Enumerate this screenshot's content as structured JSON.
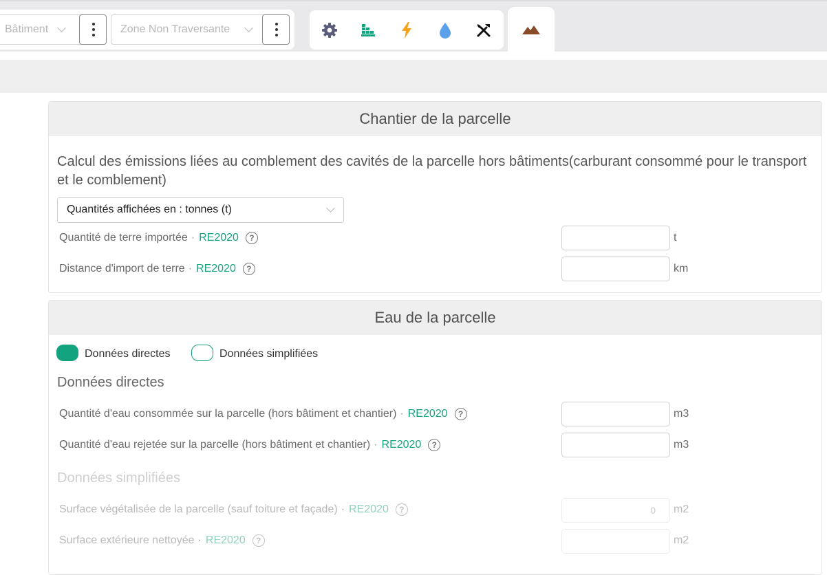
{
  "topbar": {
    "building_select": "Bâtiment",
    "zone_select": "Zone Non Traversante",
    "toolbar_icons": [
      "gear-icon",
      "bricks-icon",
      "lightning-icon",
      "water-drop-icon",
      "tools-icon"
    ],
    "active_tab_icon": "mountain-icon",
    "colors": {
      "gear": "#5b5b7a",
      "bricks": "#14a37f",
      "lightning": "#f5a21c",
      "water": "#5aa0ea",
      "tools": "#111111",
      "mountain": "#8a4b2a"
    }
  },
  "chantier": {
    "title": "Chantier de la parcelle",
    "description": "Calcul des émissions liées au comblement des cavités de la parcelle hors bâtiments(carburant consommé pour le transport et le comblement)",
    "units_select": "Quantités affichées en : tonnes (t)",
    "fields": [
      {
        "label": "Quantité de terre importée",
        "tag": "RE2020",
        "unit": "t"
      },
      {
        "label": "Distance d'import de terre",
        "tag": "RE2020",
        "unit": "km"
      }
    ]
  },
  "eau": {
    "title": "Eau de la parcelle",
    "toggle_direct": "Données directes",
    "toggle_simple": "Données simplifiées",
    "direct_heading": "Données directes",
    "direct_fields": [
      {
        "label": "Quantité d'eau consommée sur la parcelle (hors bâtiment et chantier)",
        "tag": "RE2020",
        "unit": "m3"
      },
      {
        "label": "Quantité d'eau rejetée sur la parcelle (hors bâtiment et chantier)",
        "tag": "RE2020",
        "unit": "m3"
      }
    ],
    "simple_heading": "Données simplifiées",
    "simple_fields": [
      {
        "label": "Surface végétalisée de la parcelle (sauf toiture et façade)",
        "tag": "RE2020",
        "unit": "m2",
        "value": "0"
      },
      {
        "label": "Surface extérieure nettoyée",
        "tag": "RE2020",
        "unit": "m2",
        "value": ""
      }
    ]
  },
  "ui": {
    "dot": "·",
    "help": "?"
  }
}
